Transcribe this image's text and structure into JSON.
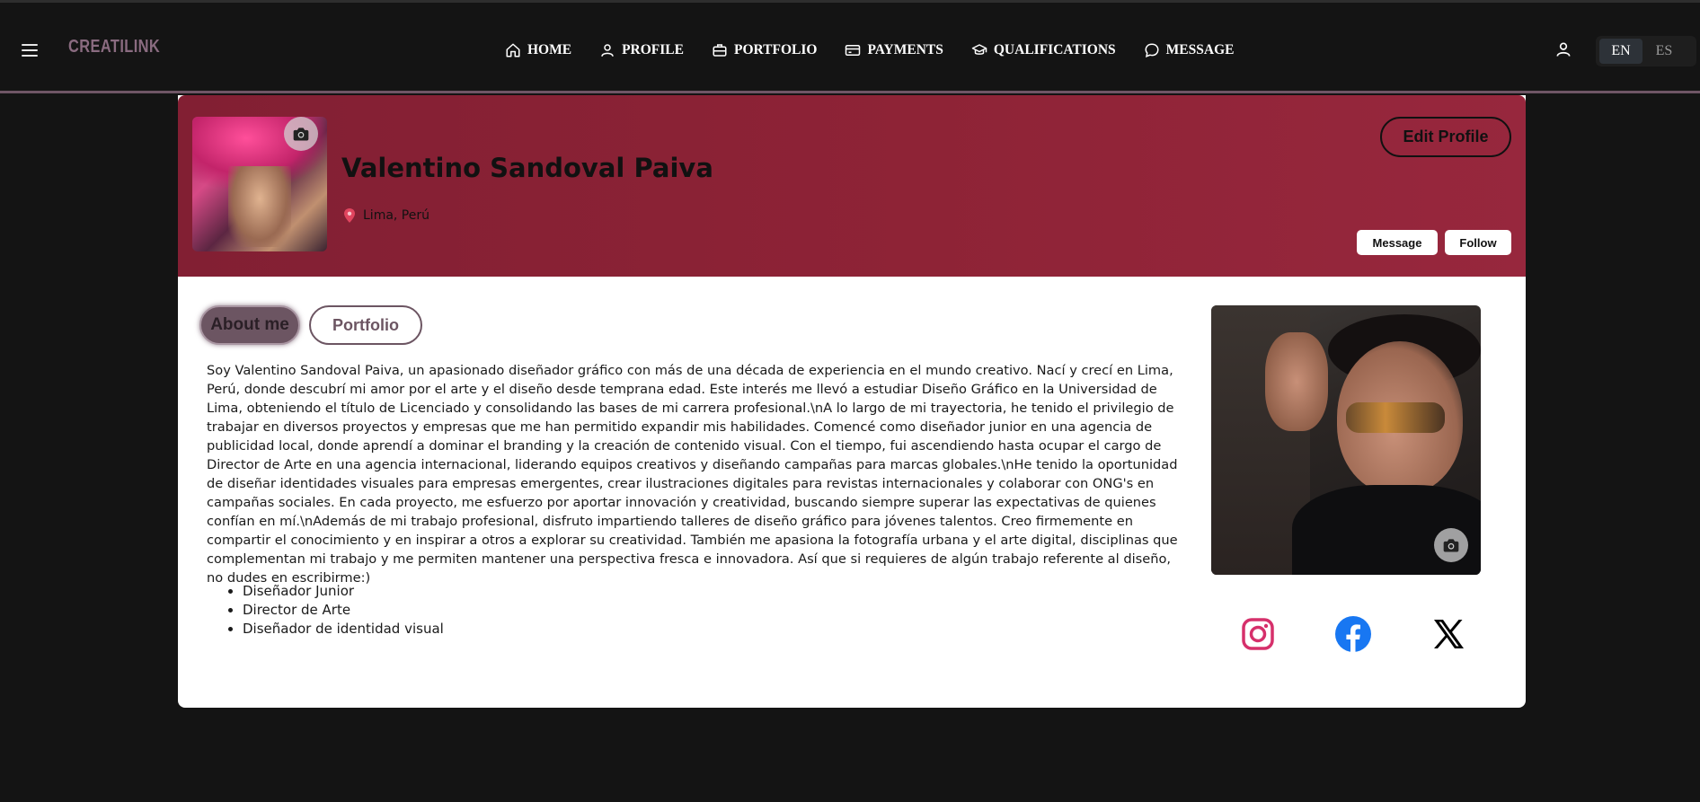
{
  "header": {
    "logo": "CREATILINK",
    "nav": [
      {
        "label": "HOME",
        "icon": "home-icon"
      },
      {
        "label": "PROFILE",
        "icon": "user-icon"
      },
      {
        "label": "PORTFOLIO",
        "icon": "briefcase-icon"
      },
      {
        "label": "PAYMENTS",
        "icon": "credit-card-icon"
      },
      {
        "label": "QUALIFICATIONS",
        "icon": "graduation-cap-icon"
      },
      {
        "label": "MESSAGE",
        "icon": "chat-icon"
      }
    ],
    "languages": [
      "EN",
      "ES"
    ],
    "active_language": "EN"
  },
  "profile": {
    "name": "Valentino Sandoval Paiva",
    "location": "Lima, Perú",
    "edit_label": "Edit Profile",
    "message_label": "Message",
    "follow_label": "Follow"
  },
  "tabs": [
    {
      "label": "About me",
      "active": true
    },
    {
      "label": "Portfolio",
      "active": false
    }
  ],
  "about": {
    "text": "Soy Valentino Sandoval Paiva, un apasionado diseñador gráfico con más de una década de experiencia en el mundo creativo. Nací y crecí en Lima, Perú, donde descubrí mi amor por el arte y el diseño desde temprana edad. Este interés me llevó a estudiar Diseño Gráfico en la Universidad de Lima, obteniendo el título de Licenciado y consolidando las bases de mi carrera profesional.\\nA lo largo de mi trayectoria, he tenido el privilegio de trabajar en diversos proyectos y empresas que me han permitido expandir mis habilidades. Comencé como diseñador junior en una agencia de publicidad local, donde aprendí a dominar el branding y la creación de contenido visual. Con el tiempo, fui ascendiendo hasta ocupar el cargo de Director de Arte en una agencia internacional, liderando equipos creativos y diseñando campañas para marcas globales.\\nHe tenido la oportunidad de diseñar identidades visuales para empresas emergentes, crear ilustraciones digitales para revistas internacionales y colaborar con ONG's en campañas sociales. En cada proyecto, me esfuerzo por aportar innovación y creatividad, buscando siempre superar las expectativas de quienes confían en mí.\\nAdemás de mi trabajo profesional, disfruto impartiendo talleres de diseño gráfico para jóvenes talentos. Creo firmemente en compartir el conocimiento y en inspirar a otros a explorar su creatividad. También me apasiona la fotografía urbana y el arte digital, disciplinas que complementan mi trabajo y me permiten mantener una perspectiva fresca e innovadora. Así que si requieres de algún trabajo referente al diseño, no dudes en escribirme:)",
    "roles": [
      "Diseñador Junior",
      "Director de Arte",
      "Diseñador de identidad visual"
    ]
  },
  "social": [
    {
      "icon": "instagram-icon",
      "color": "#d6306b"
    },
    {
      "icon": "facebook-icon",
      "color": "#1877f2"
    },
    {
      "icon": "x-icon",
      "color": "#000000"
    }
  ],
  "colors": {
    "banner": "#8e2336",
    "accent": "#6c5562",
    "background": "#141414"
  }
}
